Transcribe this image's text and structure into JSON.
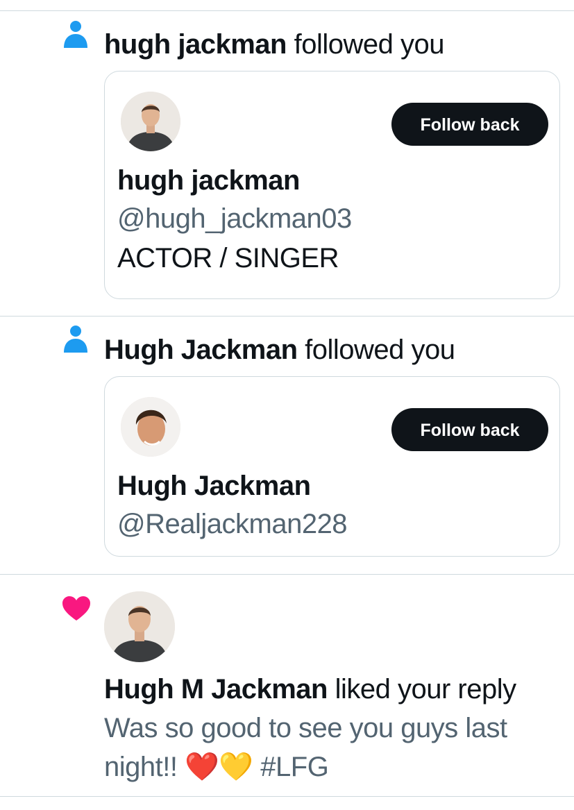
{
  "notifications": [
    {
      "type": "follow",
      "icon": "person-icon",
      "icon_color": "#1d9bf0",
      "name": "hugh jackman",
      "action": "followed you",
      "card": {
        "display_name": "hugh jackman",
        "handle": "@hugh_jackman03",
        "bio": "ACTOR / SINGER",
        "button_label": "Follow back"
      }
    },
    {
      "type": "follow",
      "icon": "person-icon",
      "icon_color": "#1d9bf0",
      "name": "Hugh Jackman",
      "action": "followed you",
      "card": {
        "display_name": "Hugh Jackman",
        "handle": "@Realjackman228",
        "button_label": "Follow back"
      }
    },
    {
      "type": "like",
      "icon": "heart-icon",
      "icon_color": "#f91880",
      "name": "Hugh M Jackman",
      "action": "liked your reply",
      "reply_text": "Was so good to see you guys last night!! ❤️💛 #LFG"
    }
  ],
  "colors": {
    "text_primary": "#0f1419",
    "text_secondary": "#536471",
    "divider": "#cfd9de",
    "button_bg": "#0f1419",
    "button_text": "#ffffff"
  }
}
